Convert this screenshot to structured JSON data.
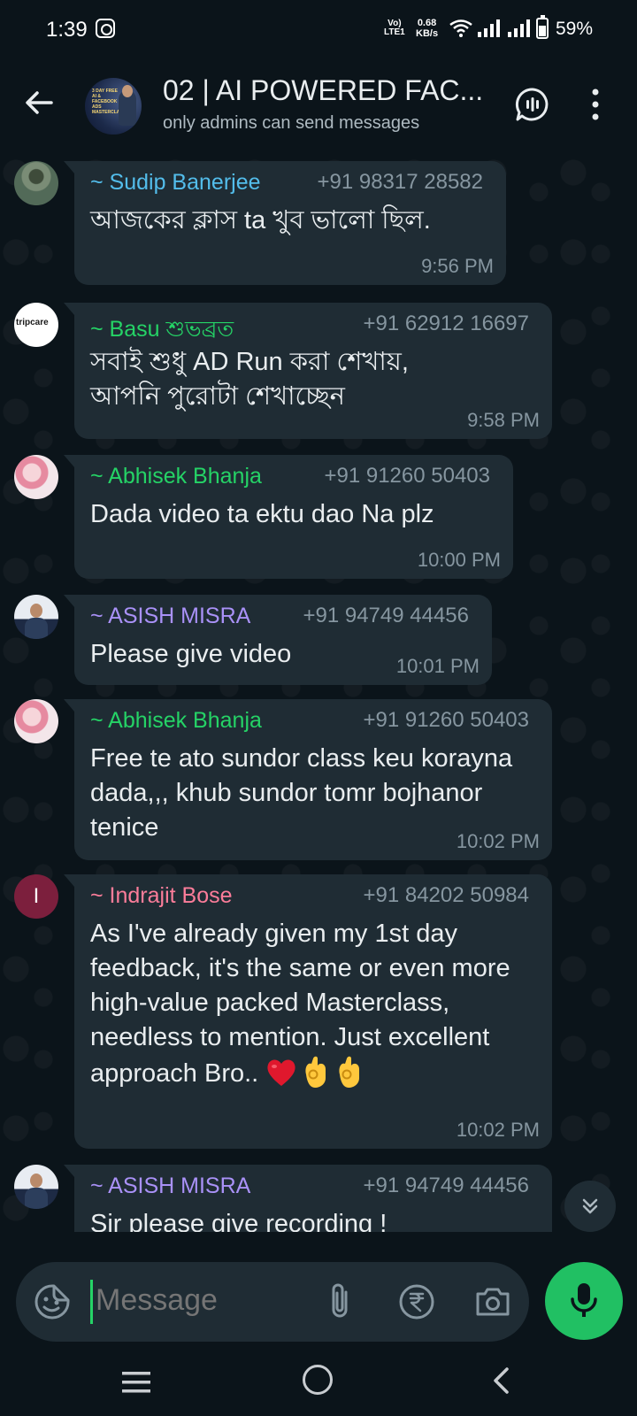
{
  "status_bar": {
    "time": "1:39",
    "network_label_1": "Vo)",
    "network_label_2": "LTE1",
    "speed_value": "0.68",
    "speed_unit": "KB/s",
    "battery": "59%"
  },
  "header": {
    "title": "02 | AI POWERED FAC...",
    "subtitle": "only admins can send messages",
    "avatar_text": "3 DAY FREE AI & FACEBOOK ADS MASTERCLASS"
  },
  "messages": [
    {
      "sender": "~ Sudip Banerjee",
      "phone": "+91 98317 28582",
      "text": "আজকের ক্লাস ta খুব ভালো ছিল.",
      "time": "9:56 PM",
      "sender_color": "#53bdeb"
    },
    {
      "sender": "~ Basu শুভব্রত",
      "phone": "+91 62912 16697",
      "text": "সবাই শুধু AD Run করা শেখায়, আপনি পুরোটা শেখাচ্ছেন",
      "time": "9:58 PM",
      "sender_color": "#25d366",
      "avatar_text": "tripcare"
    },
    {
      "sender": "~ Abhisek Bhanja",
      "phone": "+91 91260 50403",
      "text": "Dada video ta ektu dao Na plz",
      "time": "10:00 PM",
      "sender_color": "#25d366"
    },
    {
      "sender": "~ ASISH MISRA",
      "phone": "+91 94749 44456",
      "text": "Please give video",
      "time": "10:01 PM",
      "sender_color": "#a991f7"
    },
    {
      "sender": "~ Abhisek Bhanja",
      "phone": "+91 91260 50403",
      "text": "Free te ato sundor class keu korayna dada,,, khub sundor tomr bojhanor tenice",
      "time": "10:02 PM",
      "sender_color": "#25d366"
    },
    {
      "sender": "~ Indrajit Bose",
      "phone": "+91 84202 50984",
      "text": "As I've already given my 1st day feedback, it's the same or even more high-value packed Masterclass, needless to mention. Just excellent approach Bro..",
      "time": "10:02 PM",
      "sender_color": "#fc7d9a",
      "avatar_letter": "I",
      "emojis": [
        "heart-emoji",
        "ok-hand-emoji",
        "ok-hand-emoji"
      ]
    },
    {
      "sender": "~ ASISH MISRA",
      "phone": "+91 94749 44456",
      "text": "Sir please give recording !",
      "sender_color": "#a991f7"
    }
  ],
  "composer": {
    "placeholder": "Message"
  },
  "colors": {
    "background": "#0b141a",
    "bubble": "#1f2c34",
    "accent": "#25d366",
    "meta": "#8696a0"
  }
}
